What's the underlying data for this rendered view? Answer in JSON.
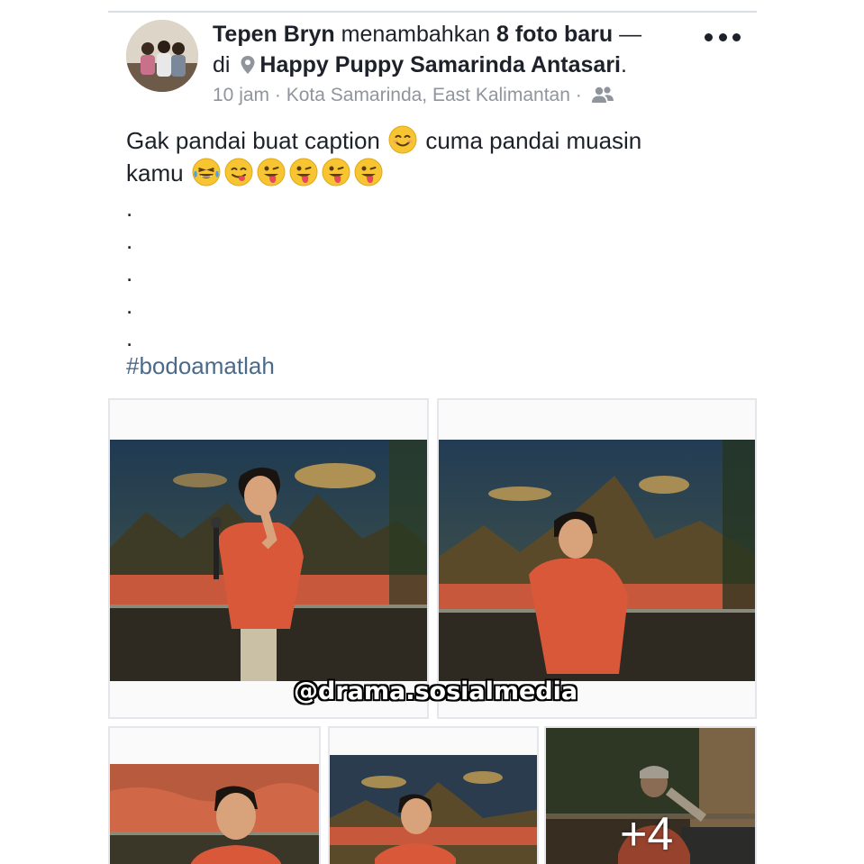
{
  "post": {
    "author": "Tepen Bryn",
    "action": "menambahkan",
    "photo_count": "8 foto baru",
    "dash": "—",
    "at": "di",
    "place": "Happy Puppy Samarinda Antasari",
    "place_end": ".",
    "time": "10 jam",
    "separator": "·",
    "location": "Kota Samarinda, East Kalimantan",
    "privacy_icon": "friends-icon",
    "more_icon": "more-options-icon",
    "caption_part1": "Gak pandai buat caption",
    "caption_part2": "cuma pandai muasin",
    "caption_line2": "kamu",
    "dots": [
      ".",
      ".",
      ".",
      ".",
      "."
    ],
    "hashtag": "#bodoamatlah"
  },
  "emojis": {
    "caption_smile": "smiling-face-emoji",
    "line2": [
      "tears-of-joy-emoji",
      "yum-face-emoji",
      "tongue-wink-emoji",
      "tongue-wink-emoji",
      "tongue-wink-emoji",
      "tongue-wink-emoji"
    ]
  },
  "photos": {
    "watermark": "@drama.sosialmedia",
    "more_count": "+4"
  },
  "colors": {
    "text": "#1d2129",
    "meta": "#90949c",
    "hashtag": "#4b6a8a",
    "shirt": "#d9583a"
  }
}
